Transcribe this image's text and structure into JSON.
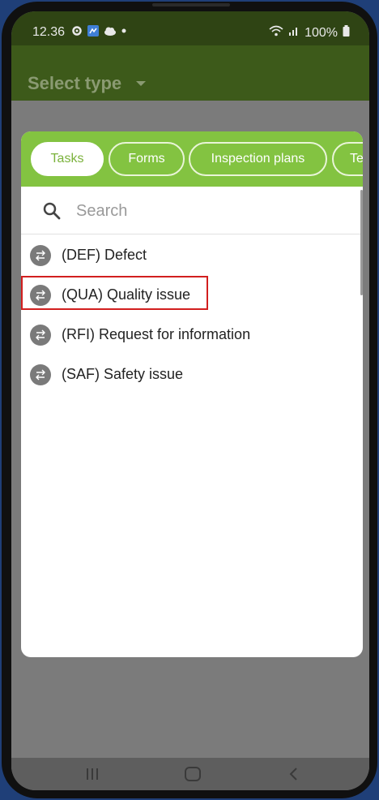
{
  "status_bar": {
    "time": "12.36",
    "battery": "100%",
    "icons": [
      "gear-icon",
      "app-icon",
      "cloud-icon",
      "dot-icon",
      "wifi-icon",
      "signal-icon",
      "battery-icon"
    ]
  },
  "app_bar": {
    "title": "Select type",
    "caret_icon": "caret-down-icon"
  },
  "dialog": {
    "tabs": [
      {
        "label": "Tasks",
        "active": true
      },
      {
        "label": "Forms",
        "active": false
      },
      {
        "label": "Inspection plans",
        "active": false
      },
      {
        "label": "Te",
        "active": false
      }
    ],
    "search": {
      "placeholder": "Search",
      "value": ""
    },
    "items": [
      {
        "label": "(DEF) Defect",
        "icon": "swap-arrows-icon"
      },
      {
        "label": "(QUA) Quality issue",
        "icon": "swap-arrows-icon",
        "highlighted": true
      },
      {
        "label": "(RFI) Request for information",
        "icon": "swap-arrows-icon"
      },
      {
        "label": "(SAF) Safety issue",
        "icon": "swap-arrows-icon"
      }
    ]
  },
  "nav_bar": {
    "buttons": [
      "recent-apps-icon",
      "home-icon",
      "back-icon"
    ]
  },
  "colors": {
    "accent_green": "#83c341",
    "app_bar_green": "#3d5a1a",
    "highlight_red": "#d21f1f"
  }
}
